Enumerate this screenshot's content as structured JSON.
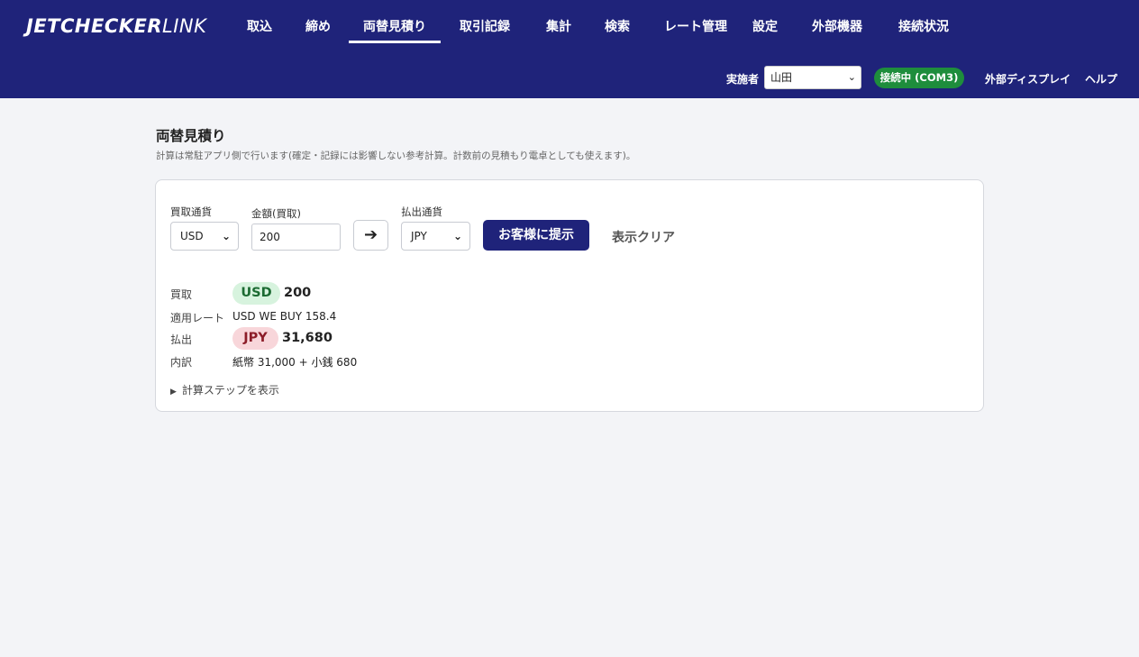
{
  "app": {
    "logo_bold": "JETCHECKER",
    "logo_light": "LINK"
  },
  "nav": {
    "tabs": [
      {
        "label": "取込"
      },
      {
        "label": "締め"
      },
      {
        "label": "両替見積り",
        "active": true
      },
      {
        "label": "取引記録"
      },
      {
        "label": "集計"
      },
      {
        "label": "検索"
      },
      {
        "label": "レート管理"
      },
      {
        "label": "設定"
      },
      {
        "label": "外部機器"
      },
      {
        "label": "接続状況"
      }
    ]
  },
  "subbar": {
    "operator_label": "実施者",
    "operator_value": "山田",
    "connection_status": "接続中 (COM3)",
    "external_display": "外部ディスプレイ",
    "help": "ヘルプ"
  },
  "page": {
    "title": "両替見積り",
    "description": "計算は常駐アプリ側で行います(確定・記録には影響しない参考計算。計数前の見積もり電卓としても使えます)。"
  },
  "form": {
    "buy_currency_label": "買取通貨",
    "buy_currency_value": "USD",
    "amount_label": "金額(買取)",
    "amount_value": "200",
    "pay_currency_label": "払出通貨",
    "pay_currency_value": "JPY",
    "present_button": "お客様に提示",
    "clear_button": "表示クリア"
  },
  "result": {
    "buy_label": "買取",
    "buy_currency": "USD",
    "buy_amount": "200",
    "rate_label": "適用レート",
    "rate_value": "USD WE BUY 158.4",
    "pay_label": "払出",
    "pay_currency": "JPY",
    "pay_amount": "31,680",
    "breakdown_label": "内訳",
    "breakdown_value": "紙幣 31,000 + 小銭 680",
    "steps_toggle": "計算ステップを表示"
  },
  "colors": {
    "header_bg": "#1f237a",
    "status_green": "#1e8d3c",
    "usd_pill": "#d7f3de",
    "jpy_pill": "#f8d6da"
  },
  "icons": {
    "arrow": "arrow-right-icon",
    "disclosure": "triangle-right-icon"
  }
}
